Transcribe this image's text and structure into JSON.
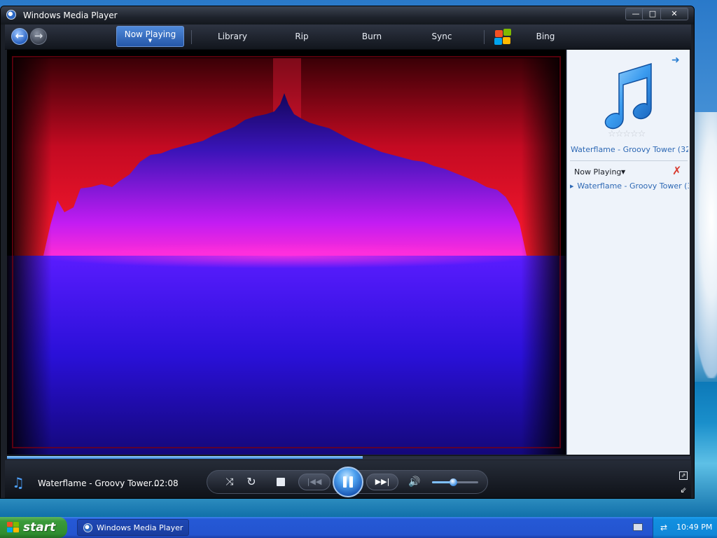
{
  "window": {
    "title": "Windows Media Player",
    "buttons": {
      "minimize": "—",
      "maximize": "□",
      "close": "✕"
    }
  },
  "nav": {
    "back_icon": "back-arrow-icon",
    "forward_icon": "forward-arrow-icon",
    "tabs": [
      {
        "label": "Now Playing",
        "active": true
      },
      {
        "label": "Library",
        "active": false
      },
      {
        "label": "Rip",
        "active": false
      },
      {
        "label": "Burn",
        "active": false
      },
      {
        "label": "Sync",
        "active": false
      },
      {
        "label": "Bing",
        "active": false
      }
    ]
  },
  "visualization": {
    "colors": {
      "top": "#e0102a",
      "bottom": "#3a10ff",
      "wave": "#1a0a8a",
      "glow": "#ff20d0"
    }
  },
  "right_pane": {
    "track_title": "Waterflame - Groovy Tower (32...",
    "rating_stars": "☆☆☆☆☆",
    "now_playing_label": "Now Playing",
    "playlist": [
      "Waterflame - Groovy Tower (3..."
    ]
  },
  "player": {
    "track": "Waterflame - Groovy Tower...",
    "time": "02:08",
    "seek_progress_percent": 52,
    "volume_percent": 45,
    "accent": "#2f7fd8"
  },
  "taskbar": {
    "start_label": "start",
    "task_button": "Windows Media Player",
    "clock": "10:49 PM"
  }
}
